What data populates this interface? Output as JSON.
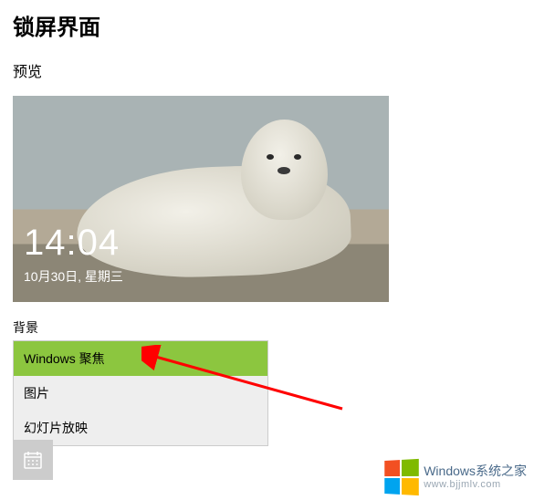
{
  "page": {
    "title": "锁屏界面",
    "preview_label": "预览",
    "background_label": "背景"
  },
  "preview": {
    "time": "14:04",
    "date": "10月30日, 星期三"
  },
  "background_dropdown": {
    "options": [
      {
        "label": "Windows 聚焦",
        "selected": true
      },
      {
        "label": "图片",
        "selected": false
      },
      {
        "label": "幻灯片放映",
        "selected": false
      }
    ]
  },
  "icons": {
    "calendar": "calendar-icon"
  },
  "watermark": {
    "brand_en": "Windows",
    "brand_cn": "系统之家",
    "url": "www.bjjmlv.com"
  },
  "colors": {
    "highlight": "#8cc63f",
    "arrow": "#ff0000"
  }
}
